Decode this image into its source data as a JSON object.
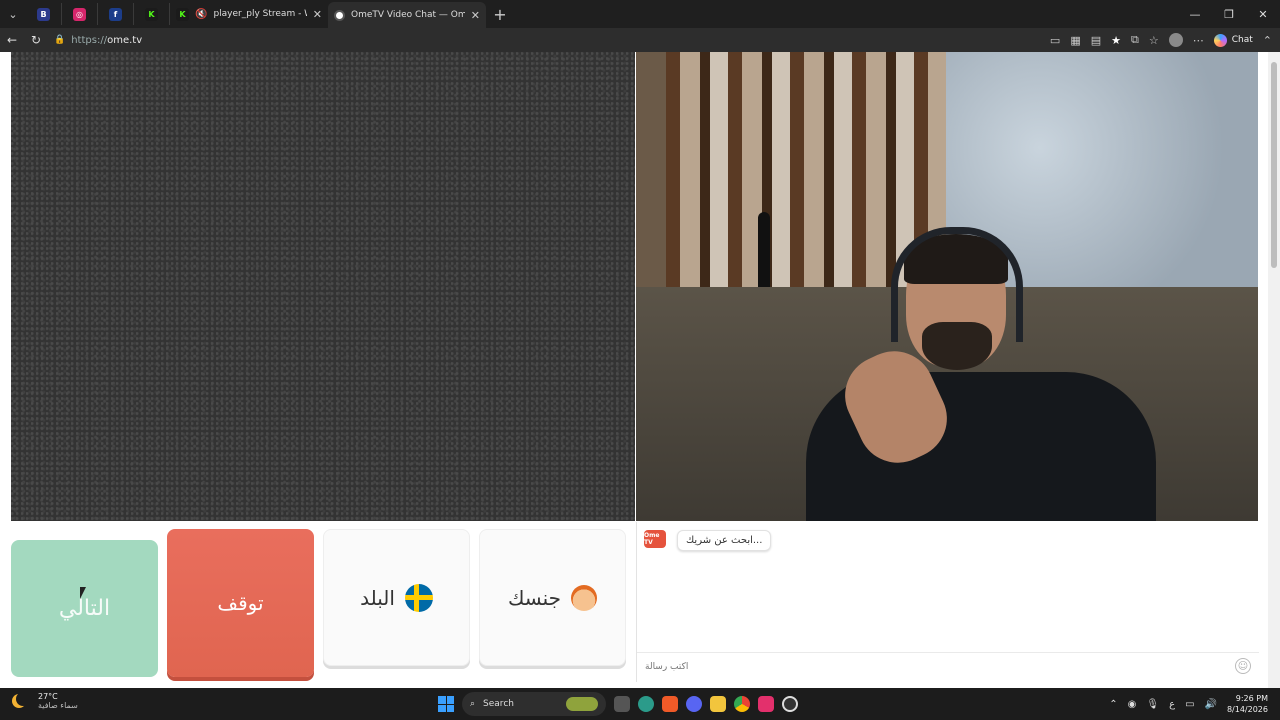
{
  "browser": {
    "tabs": [
      {
        "type": "small",
        "favicon": "vk-icon",
        "color": "#2c3a8c",
        "glyph": "B"
      },
      {
        "type": "small",
        "favicon": "instagram-icon",
        "color": "#d6266b",
        "glyph": "◎"
      },
      {
        "type": "small",
        "favicon": "facebook-icon",
        "color": "#1c3d8a",
        "glyph": "f"
      },
      {
        "type": "small",
        "favicon": "kick-icon",
        "color": "#1b1b1b",
        "glyph": "K"
      },
      {
        "type": "wide",
        "title": "player_ply Stream - Watch Live",
        "favicon": "kick-icon",
        "muted": true
      },
      {
        "type": "active",
        "title": "OmeTV Video Chat — Omegle"
      }
    ],
    "url_protocol": "https://",
    "url_host": "ome.tv",
    "chat_label": "Chat"
  },
  "controls": {
    "next_label": "التالي",
    "stop_label": "توقف",
    "country_label": "البلد",
    "gender_label": "جنسك"
  },
  "chat": {
    "logo_text": "Ome TV",
    "status_message": "...ابحث عن شريك",
    "input_placeholder": "اكتب رسالة"
  },
  "taskbar": {
    "temperature": "27°C",
    "weather_desc": "سماء صافية",
    "search_label": "Search",
    "input_lang": "ع",
    "time": "9:26 PM",
    "date": "8/14/2026"
  },
  "colors": {
    "next_button": "#a3d9bf",
    "stop_button": "#e96e5d",
    "brand": "#e5533d"
  }
}
